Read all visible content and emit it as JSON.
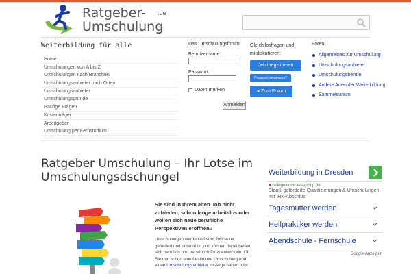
{
  "brand": {
    "line1": "Ratgeber-",
    "line2": "Umschulung",
    "tld": ".de"
  },
  "search": {
    "placeholder": ""
  },
  "sidebar": {
    "title": "Weiterbildung für alle",
    "items": [
      "Home",
      "Umschulungen von A bis Z",
      "Umschulungen nach Branchen",
      "Umschulungsanbieter nach Orten",
      "Umschulungsanbieter",
      "Umschulungsgründe",
      "Häufige Fragen",
      "Kostenträger",
      "Arbeitgeber",
      "Umschulung per Fernstudium"
    ]
  },
  "forum": {
    "title": "Das Umschulungsforum",
    "username_label": "Benutzername:",
    "password_label": "Passwort:",
    "remember_label": "Daten merken",
    "login_button": "Anmelden"
  },
  "join": {
    "text": "Gleich losfragen und mitdiskutieren:",
    "register_button": "Jetzt registrieren",
    "forgot_button": "Passwort vergessen?",
    "forum_button": "Zum Forum"
  },
  "foren": {
    "title": "Foren",
    "items": [
      "Allgemeines zur Umschulung",
      "Umschulungsanbieter",
      "Umschulungsberufe",
      "Andere Arten der Weiterbildung",
      "Sammelsurium"
    ]
  },
  "main": {
    "title": "Ratgeber Umschulung – Ihr Lotse im Umschulungsdschungel",
    "intro_bold": "Sie sind in Ihrem alten Job nicht zufrieden, schon lange arbeitslos  oder wollen sich neue berufliche Perspektiven eröffnen?",
    "body_text": "Umschulungen werden oft vom Jobcenter gefördert und unterstützt und können dabei helfen, sich beruflich und persönlich fortzuentwickeln. Ob Sie nun schon eine bestimmte Umschulung und einen",
    "body_link": "Umschulungsanbieter",
    "body_tail": " im Auge haben oder"
  },
  "ad": {
    "title": "Weiterbildung in Dresden",
    "domain": "college.comcave-group.de",
    "description": "Staatl. geförderte Qualifizierungen & Umschulungen mit IHK-Abschlus",
    "rows": [
      "Tagesmutter werden",
      "Heilpraktiker werden",
      "Abendschule - Fernschule"
    ],
    "badge": "Google-Anzeigen"
  },
  "colors": {
    "accent": "#e05a3a",
    "link": "#1e3aa8",
    "button": "#2a7de1",
    "ad_arrow": "#4caf50"
  }
}
